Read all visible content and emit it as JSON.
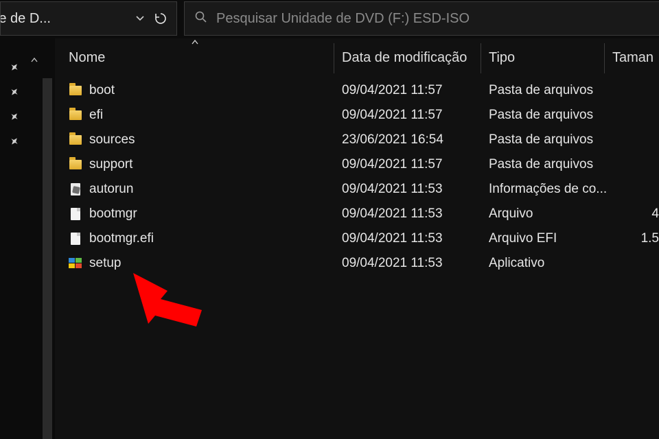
{
  "addressbar": {
    "path_truncated": "dade de D..."
  },
  "search": {
    "placeholder": "Pesquisar Unidade de DVD (F:) ESD-ISO"
  },
  "columns": {
    "name": "Nome",
    "date": "Data de modificação",
    "type": "Tipo",
    "size": "Taman"
  },
  "files": [
    {
      "icon": "folder",
      "name": "boot",
      "date": "09/04/2021 11:57",
      "type": "Pasta de arquivos",
      "size": ""
    },
    {
      "icon": "folder",
      "name": "efi",
      "date": "09/04/2021 11:57",
      "type": "Pasta de arquivos",
      "size": ""
    },
    {
      "icon": "folder",
      "name": "sources",
      "date": "23/06/2021 16:54",
      "type": "Pasta de arquivos",
      "size": ""
    },
    {
      "icon": "folder",
      "name": "support",
      "date": "09/04/2021 11:57",
      "type": "Pasta de arquivos",
      "size": ""
    },
    {
      "icon": "inf",
      "name": "autorun",
      "date": "09/04/2021 11:53",
      "type": "Informações de co...",
      "size": ""
    },
    {
      "icon": "file",
      "name": "bootmgr",
      "date": "09/04/2021 11:53",
      "type": "Arquivo",
      "size": "4"
    },
    {
      "icon": "file",
      "name": "bootmgr.efi",
      "date": "09/04/2021 11:53",
      "type": "Arquivo EFI",
      "size": "1.5"
    },
    {
      "icon": "app",
      "name": "setup",
      "date": "09/04/2021 11:53",
      "type": "Aplicativo",
      "size": ""
    }
  ],
  "annotation": {
    "target": "setup",
    "color": "#ff0000"
  }
}
